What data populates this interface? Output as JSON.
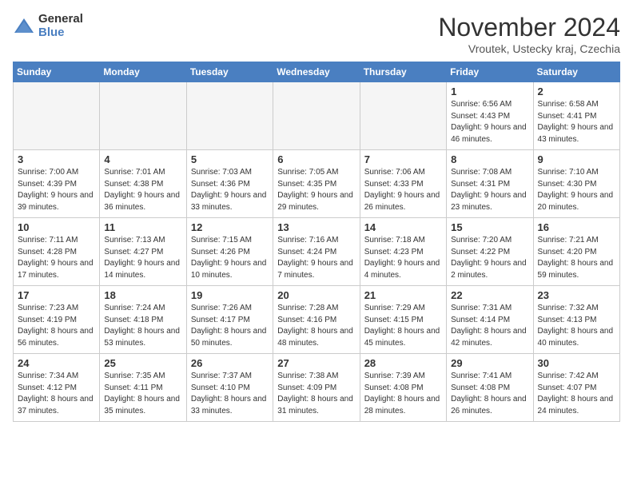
{
  "logo": {
    "general": "General",
    "blue": "Blue"
  },
  "title": "November 2024",
  "location": "Vroutek, Ustecky kraj, Czechia",
  "headers": [
    "Sunday",
    "Monday",
    "Tuesday",
    "Wednesday",
    "Thursday",
    "Friday",
    "Saturday"
  ],
  "weeks": [
    [
      {
        "day": "",
        "info": "",
        "empty": true
      },
      {
        "day": "",
        "info": "",
        "empty": true
      },
      {
        "day": "",
        "info": "",
        "empty": true
      },
      {
        "day": "",
        "info": "",
        "empty": true
      },
      {
        "day": "",
        "info": "",
        "empty": true
      },
      {
        "day": "1",
        "info": "Sunrise: 6:56 AM\nSunset: 4:43 PM\nDaylight: 9 hours\nand 46 minutes.",
        "empty": false
      },
      {
        "day": "2",
        "info": "Sunrise: 6:58 AM\nSunset: 4:41 PM\nDaylight: 9 hours\nand 43 minutes.",
        "empty": false
      }
    ],
    [
      {
        "day": "3",
        "info": "Sunrise: 7:00 AM\nSunset: 4:39 PM\nDaylight: 9 hours\nand 39 minutes.",
        "empty": false
      },
      {
        "day": "4",
        "info": "Sunrise: 7:01 AM\nSunset: 4:38 PM\nDaylight: 9 hours\nand 36 minutes.",
        "empty": false
      },
      {
        "day": "5",
        "info": "Sunrise: 7:03 AM\nSunset: 4:36 PM\nDaylight: 9 hours\nand 33 minutes.",
        "empty": false
      },
      {
        "day": "6",
        "info": "Sunrise: 7:05 AM\nSunset: 4:35 PM\nDaylight: 9 hours\nand 29 minutes.",
        "empty": false
      },
      {
        "day": "7",
        "info": "Sunrise: 7:06 AM\nSunset: 4:33 PM\nDaylight: 9 hours\nand 26 minutes.",
        "empty": false
      },
      {
        "day": "8",
        "info": "Sunrise: 7:08 AM\nSunset: 4:31 PM\nDaylight: 9 hours\nand 23 minutes.",
        "empty": false
      },
      {
        "day": "9",
        "info": "Sunrise: 7:10 AM\nSunset: 4:30 PM\nDaylight: 9 hours\nand 20 minutes.",
        "empty": false
      }
    ],
    [
      {
        "day": "10",
        "info": "Sunrise: 7:11 AM\nSunset: 4:28 PM\nDaylight: 9 hours\nand 17 minutes.",
        "empty": false
      },
      {
        "day": "11",
        "info": "Sunrise: 7:13 AM\nSunset: 4:27 PM\nDaylight: 9 hours\nand 14 minutes.",
        "empty": false
      },
      {
        "day": "12",
        "info": "Sunrise: 7:15 AM\nSunset: 4:26 PM\nDaylight: 9 hours\nand 10 minutes.",
        "empty": false
      },
      {
        "day": "13",
        "info": "Sunrise: 7:16 AM\nSunset: 4:24 PM\nDaylight: 9 hours\nand 7 minutes.",
        "empty": false
      },
      {
        "day": "14",
        "info": "Sunrise: 7:18 AM\nSunset: 4:23 PM\nDaylight: 9 hours\nand 4 minutes.",
        "empty": false
      },
      {
        "day": "15",
        "info": "Sunrise: 7:20 AM\nSunset: 4:22 PM\nDaylight: 9 hours\nand 2 minutes.",
        "empty": false
      },
      {
        "day": "16",
        "info": "Sunrise: 7:21 AM\nSunset: 4:20 PM\nDaylight: 8 hours\nand 59 minutes.",
        "empty": false
      }
    ],
    [
      {
        "day": "17",
        "info": "Sunrise: 7:23 AM\nSunset: 4:19 PM\nDaylight: 8 hours\nand 56 minutes.",
        "empty": false
      },
      {
        "day": "18",
        "info": "Sunrise: 7:24 AM\nSunset: 4:18 PM\nDaylight: 8 hours\nand 53 minutes.",
        "empty": false
      },
      {
        "day": "19",
        "info": "Sunrise: 7:26 AM\nSunset: 4:17 PM\nDaylight: 8 hours\nand 50 minutes.",
        "empty": false
      },
      {
        "day": "20",
        "info": "Sunrise: 7:28 AM\nSunset: 4:16 PM\nDaylight: 8 hours\nand 48 minutes.",
        "empty": false
      },
      {
        "day": "21",
        "info": "Sunrise: 7:29 AM\nSunset: 4:15 PM\nDaylight: 8 hours\nand 45 minutes.",
        "empty": false
      },
      {
        "day": "22",
        "info": "Sunrise: 7:31 AM\nSunset: 4:14 PM\nDaylight: 8 hours\nand 42 minutes.",
        "empty": false
      },
      {
        "day": "23",
        "info": "Sunrise: 7:32 AM\nSunset: 4:13 PM\nDaylight: 8 hours\nand 40 minutes.",
        "empty": false
      }
    ],
    [
      {
        "day": "24",
        "info": "Sunrise: 7:34 AM\nSunset: 4:12 PM\nDaylight: 8 hours\nand 37 minutes.",
        "empty": false
      },
      {
        "day": "25",
        "info": "Sunrise: 7:35 AM\nSunset: 4:11 PM\nDaylight: 8 hours\nand 35 minutes.",
        "empty": false
      },
      {
        "day": "26",
        "info": "Sunrise: 7:37 AM\nSunset: 4:10 PM\nDaylight: 8 hours\nand 33 minutes.",
        "empty": false
      },
      {
        "day": "27",
        "info": "Sunrise: 7:38 AM\nSunset: 4:09 PM\nDaylight: 8 hours\nand 31 minutes.",
        "empty": false
      },
      {
        "day": "28",
        "info": "Sunrise: 7:39 AM\nSunset: 4:08 PM\nDaylight: 8 hours\nand 28 minutes.",
        "empty": false
      },
      {
        "day": "29",
        "info": "Sunrise: 7:41 AM\nSunset: 4:08 PM\nDaylight: 8 hours\nand 26 minutes.",
        "empty": false
      },
      {
        "day": "30",
        "info": "Sunrise: 7:42 AM\nSunset: 4:07 PM\nDaylight: 8 hours\nand 24 minutes.",
        "empty": false
      }
    ]
  ]
}
